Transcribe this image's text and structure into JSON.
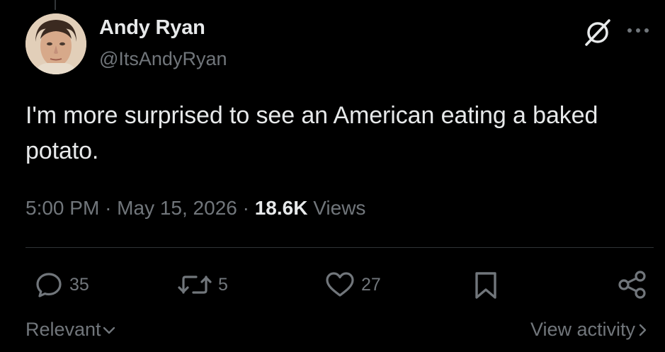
{
  "author": {
    "display_name": "Andy Ryan",
    "handle": "@ItsAndyRyan"
  },
  "tweet": {
    "text": "I'm more surprised to see an American eating a baked potato.",
    "time": "5:00 PM",
    "date": "May 15, 2026",
    "views_count": "18.6K",
    "views_label": "Views"
  },
  "actions": {
    "reply_count": "35",
    "repost_count": "5",
    "like_count": "27"
  },
  "footer": {
    "sort_label": "Relevant",
    "activity_label": "View activity"
  },
  "icons": {
    "top_right": [
      "grok-icon",
      "more-icon"
    ],
    "actions": [
      "reply-icon",
      "repost-icon",
      "like-icon",
      "bookmark-icon",
      "share-icon"
    ],
    "footer": [
      "chevron-down-icon",
      "chevron-right-icon"
    ]
  },
  "colors": {
    "background": "#000000",
    "primary_text": "#e7e9ea",
    "secondary_text": "#71767b",
    "divider": "#2f3336"
  }
}
